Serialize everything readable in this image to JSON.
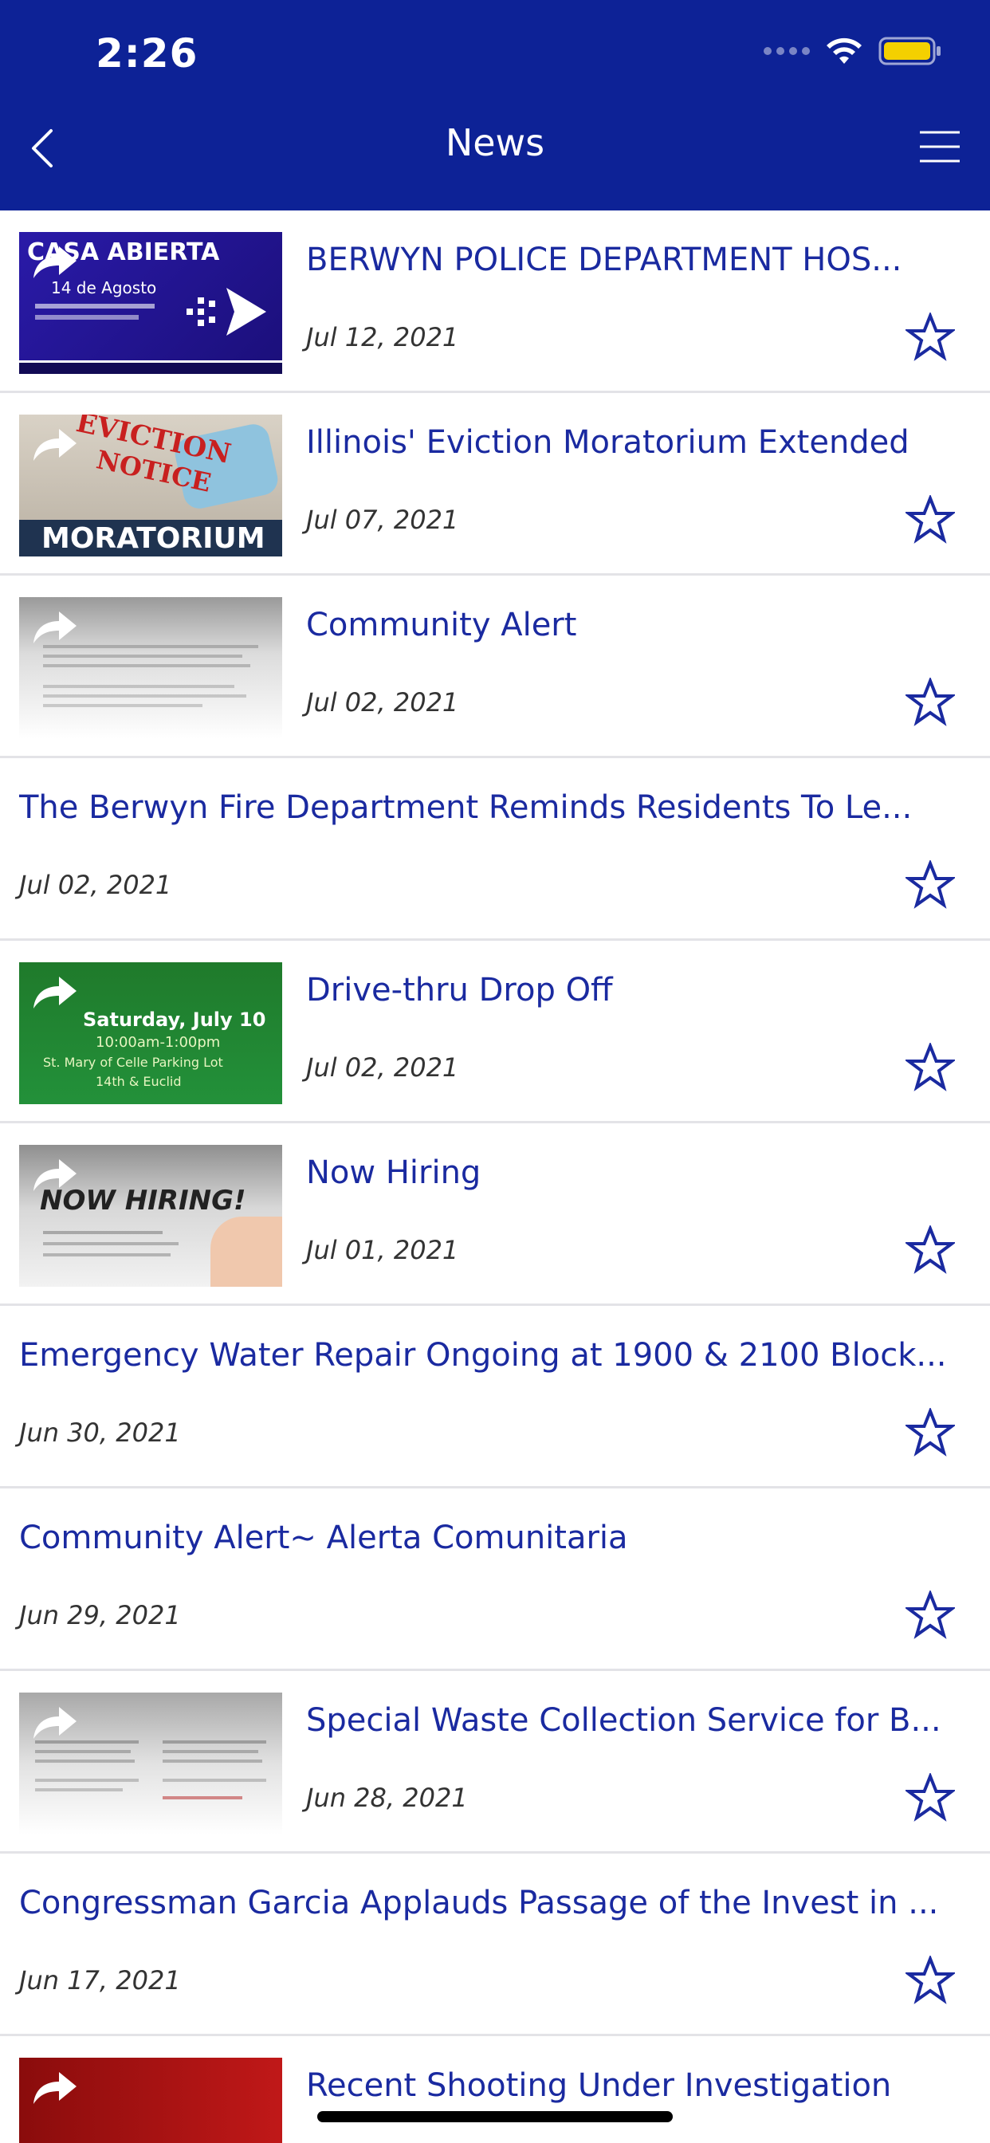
{
  "status_bar": {
    "time": "2:26"
  },
  "nav": {
    "title": "News"
  },
  "colors": {
    "primary": "#0d2296",
    "title_text": "#1a2aa0",
    "star": "#1a2aa0"
  },
  "items": [
    {
      "title": "BERWYN POLICE DEPARTMENT HOS...",
      "date": "Jul 12, 2021",
      "has_image": true
    },
    {
      "title": "Illinois' Eviction Moratorium Extended",
      "date": "Jul 07, 2021",
      "has_image": true
    },
    {
      "title": "Community Alert",
      "date": "Jul 02, 2021",
      "has_image": true
    },
    {
      "title": "The Berwyn Fire Department Reminds Residents To Le...",
      "date": "Jul 02, 2021",
      "has_image": false
    },
    {
      "title": "Drive-thru Drop Off",
      "date": "Jul 02, 2021",
      "has_image": true
    },
    {
      "title": "Now Hiring",
      "date": "Jul 01, 2021",
      "has_image": true
    },
    {
      "title": "Emergency Water Repair Ongoing at 1900 & 2100 Block...",
      "date": "Jun 30, 2021",
      "has_image": false
    },
    {
      "title": "Community Alert~ Alerta Comunitaria",
      "date": "Jun 29, 2021",
      "has_image": false
    },
    {
      "title": "Special Waste Collection Service for B...",
      "date": "Jun 28, 2021",
      "has_image": true
    },
    {
      "title": "Congressman Garcia Applauds Passage of the Invest in ...",
      "date": "Jun 17, 2021",
      "has_image": false
    },
    {
      "title": "Recent Shooting Under Investigation",
      "date": "",
      "has_image": true
    }
  ],
  "thumb_text": {
    "casa_title": "CASA ABIERTA",
    "casa_sub": "14 de Agosto",
    "eviction_line1": "EVICTION",
    "eviction_line2": "NOTICE",
    "eviction_banner": "MORATORIUM",
    "drive_line1": "Saturday, July 10",
    "drive_line2": "10:00am-1:00pm",
    "drive_line3": "St. Mary of Celle Parking Lot",
    "drive_line4": "14th & Euclid",
    "hiring_text": "NOW HIRING!"
  }
}
